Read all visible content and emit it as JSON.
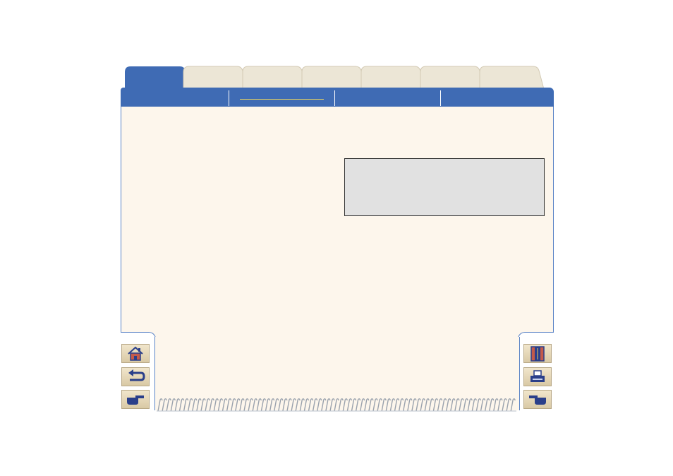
{
  "tabs": [
    {
      "label": "",
      "active": true
    },
    {
      "label": "",
      "active": false
    },
    {
      "label": "",
      "active": false
    },
    {
      "label": "",
      "active": false
    },
    {
      "label": "",
      "active": false
    },
    {
      "label": "",
      "active": false
    },
    {
      "label": "",
      "active": false
    }
  ],
  "header": {
    "sections": [
      "",
      "",
      "",
      ""
    ]
  },
  "content": {
    "note_box": ""
  },
  "nav_left": {
    "home": "home-icon",
    "back": "back-arrow-icon",
    "next": "pointing-hand-right-icon"
  },
  "nav_right": {
    "contents": "contents-book-icon",
    "print": "printer-icon",
    "prev": "pointing-hand-left-icon"
  },
  "colors": {
    "header_blue": "#3f6bb4",
    "active_tab": "#3f6bb4",
    "inactive_tab": "#ece6d6",
    "panel": "#fdf6ec",
    "note_box": "#e1e1e1",
    "underline": "#f2d85c"
  }
}
